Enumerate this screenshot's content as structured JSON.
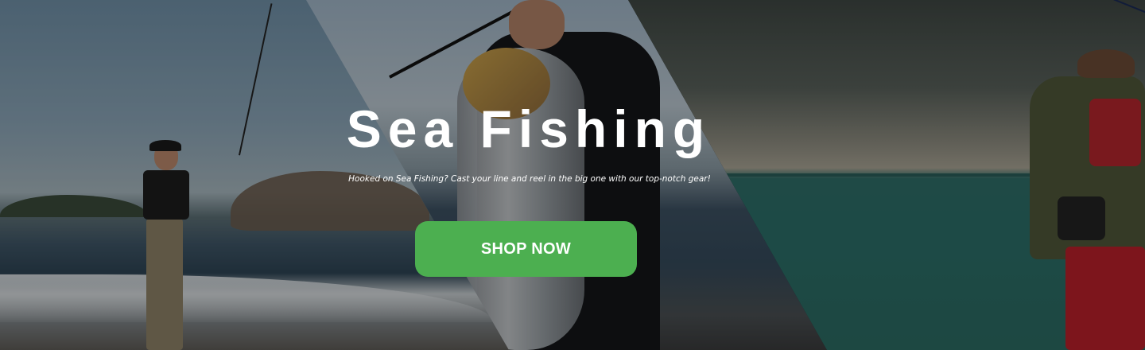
{
  "hero": {
    "title": "Sea Fishing",
    "subtitle": "Hooked on Sea Fishing? Cast your line and reel in the big one with our  top-notch gear!",
    "cta_label": "SHOP NOW"
  },
  "colors": {
    "cta_background": "#4caf50",
    "text": "#ffffff"
  }
}
